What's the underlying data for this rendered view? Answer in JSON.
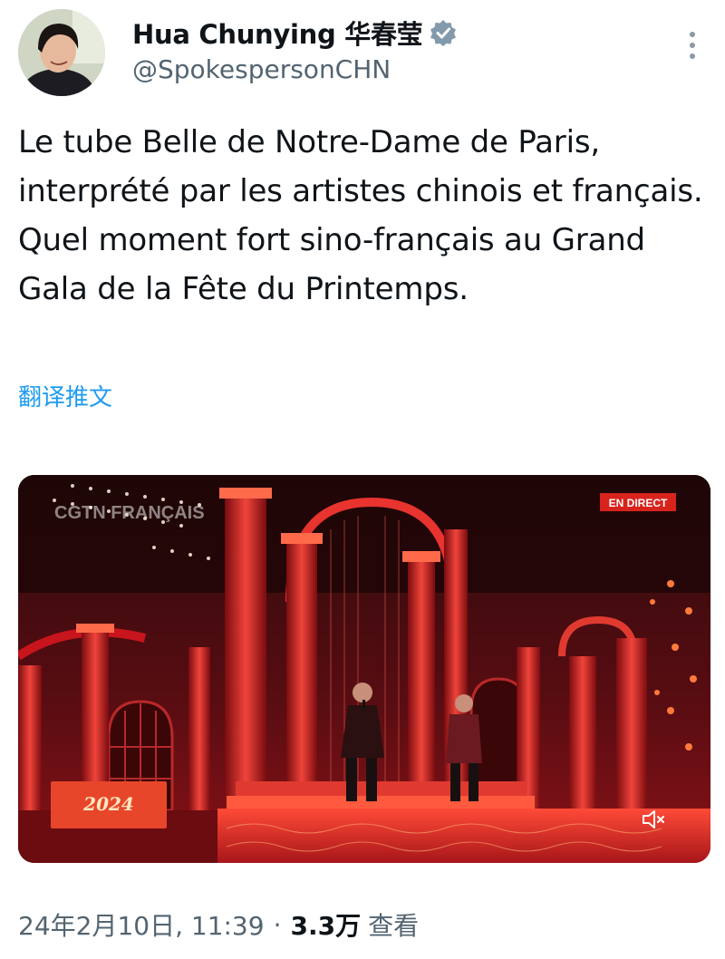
{
  "header": {
    "display_name": "Hua Chunying 华春莹",
    "handle": "@SpokespersonCHN",
    "verified_icon": "verified-badge-icon",
    "more_icon": "more-vertical-icon"
  },
  "tweet": {
    "text": "Le tube Belle de Notre-Dame de Paris, interprété par les artistes chinois et français. Quel moment fort sino-français au Grand Gala de la Fête du Printemps.",
    "translate_label": "翻译推文"
  },
  "media": {
    "channel_watermark": "CGTN FRANÇAIS",
    "live_badge": "EN DIRECT",
    "mute_icon": "speaker-muted-icon",
    "gala_logo_text": "2024"
  },
  "footer": {
    "timestamp": "24年2月10日, 11:39",
    "separator": "·",
    "views_count": "3.3万",
    "views_label": "查看"
  },
  "colors": {
    "link": "#1d9bf0",
    "verified": "#829aab",
    "secondary_text": "#536471",
    "primary_text": "#0f1419",
    "stage_red": "#c8141c"
  }
}
